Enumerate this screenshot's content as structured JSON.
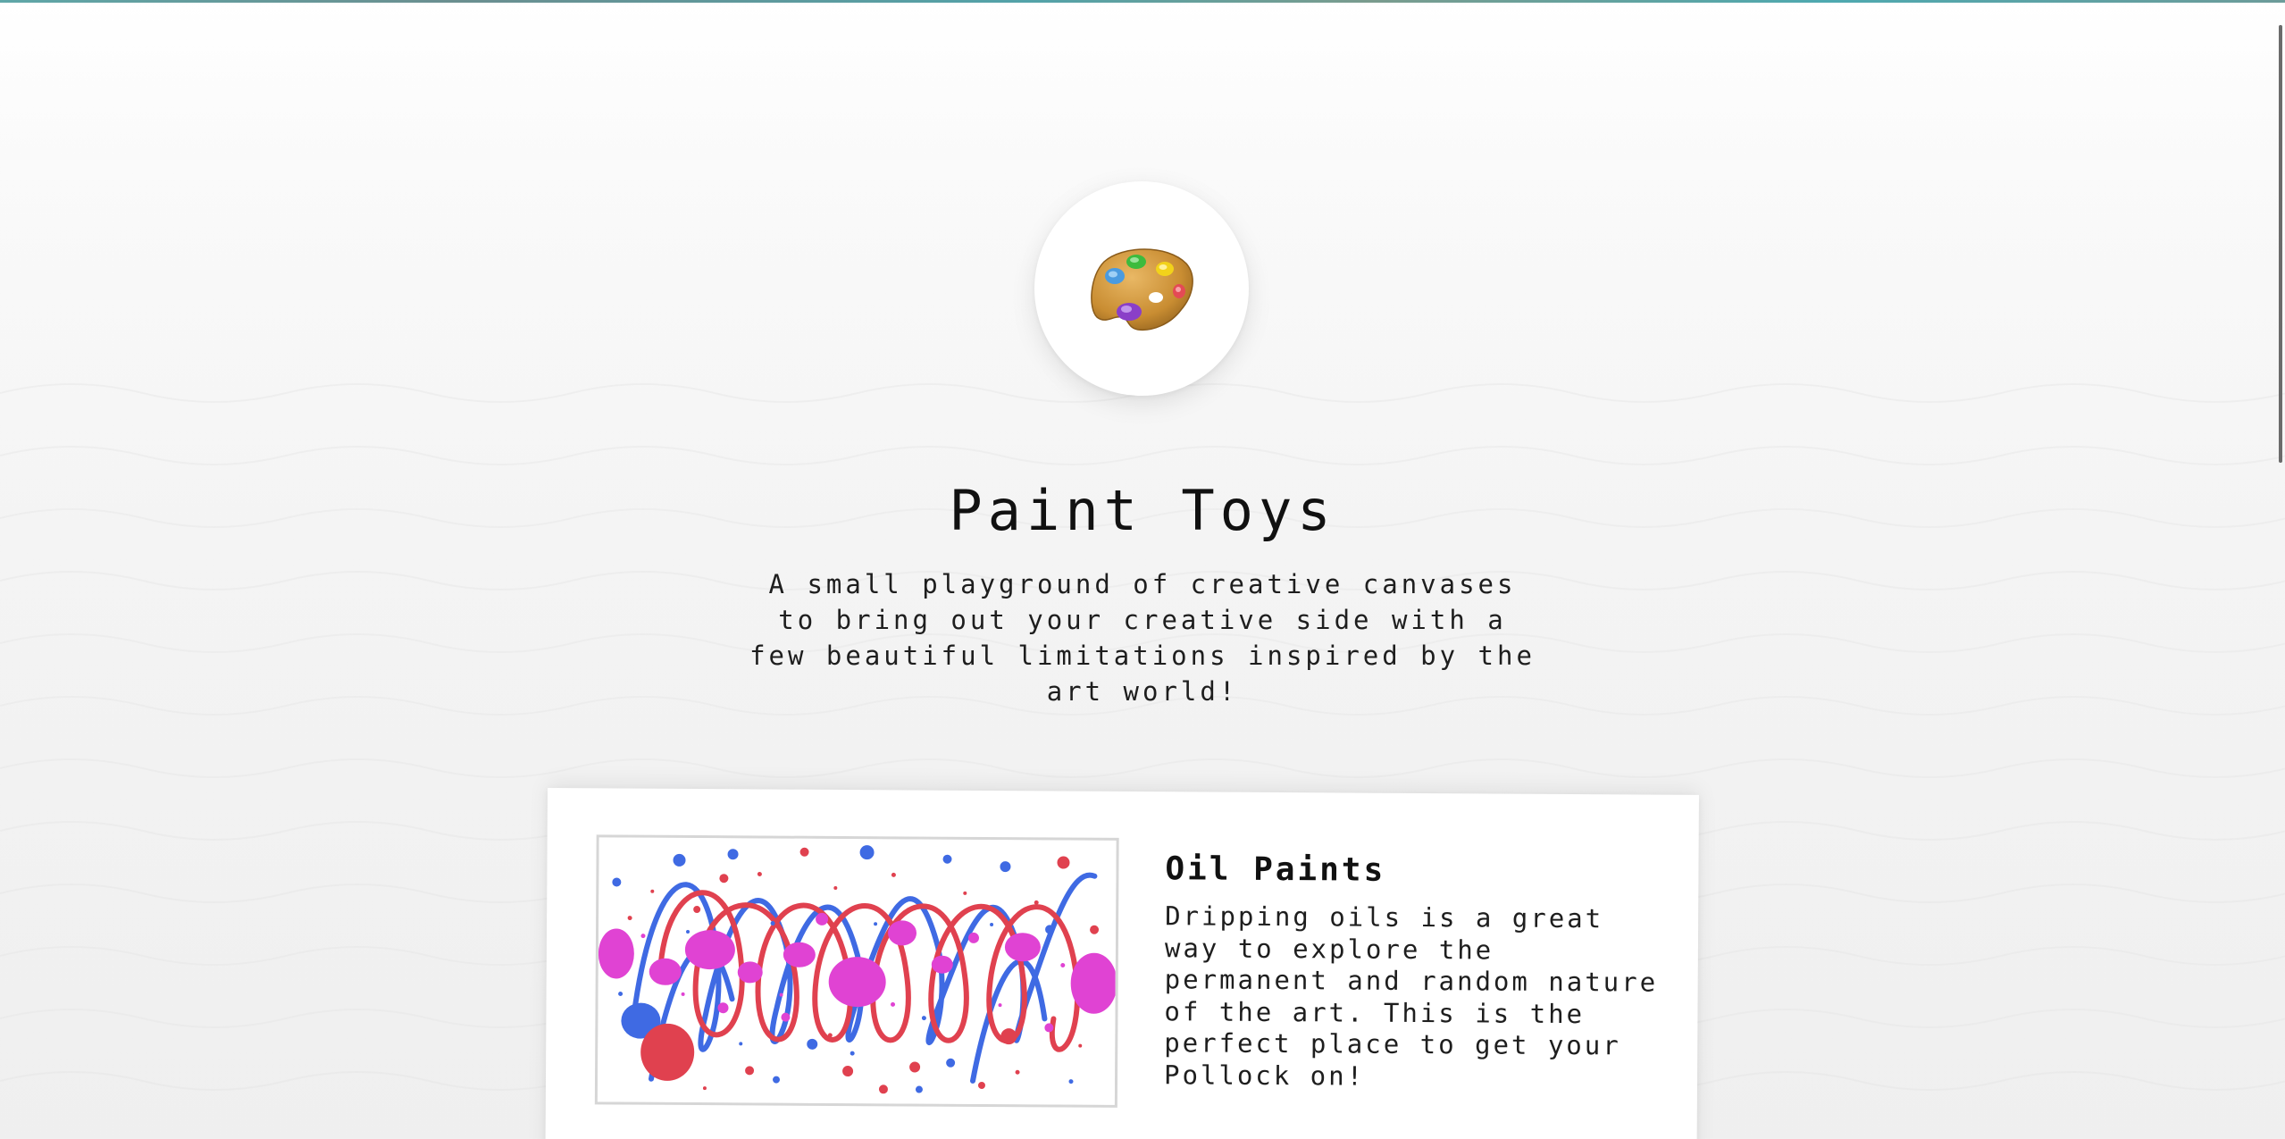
{
  "header": {
    "logo_icon": "artist-palette-icon",
    "title": "Paint Toys",
    "subtitle": "A small playground of creative canvases to bring out your creative side with a few beautiful limitations inspired by the art world!"
  },
  "cards": [
    {
      "title": "Oil Paints",
      "description": "Dripping oils is a great way to explore the permanent and random nature of the art. This is the perfect place to get your Pollock on!",
      "image_icon": "paint-splatter-preview"
    }
  ],
  "colors": {
    "splatter_red": "#e0414f",
    "splatter_blue": "#3f6ae3",
    "splatter_magenta": "#e043d3",
    "palette_wood": "#d39a3c"
  }
}
